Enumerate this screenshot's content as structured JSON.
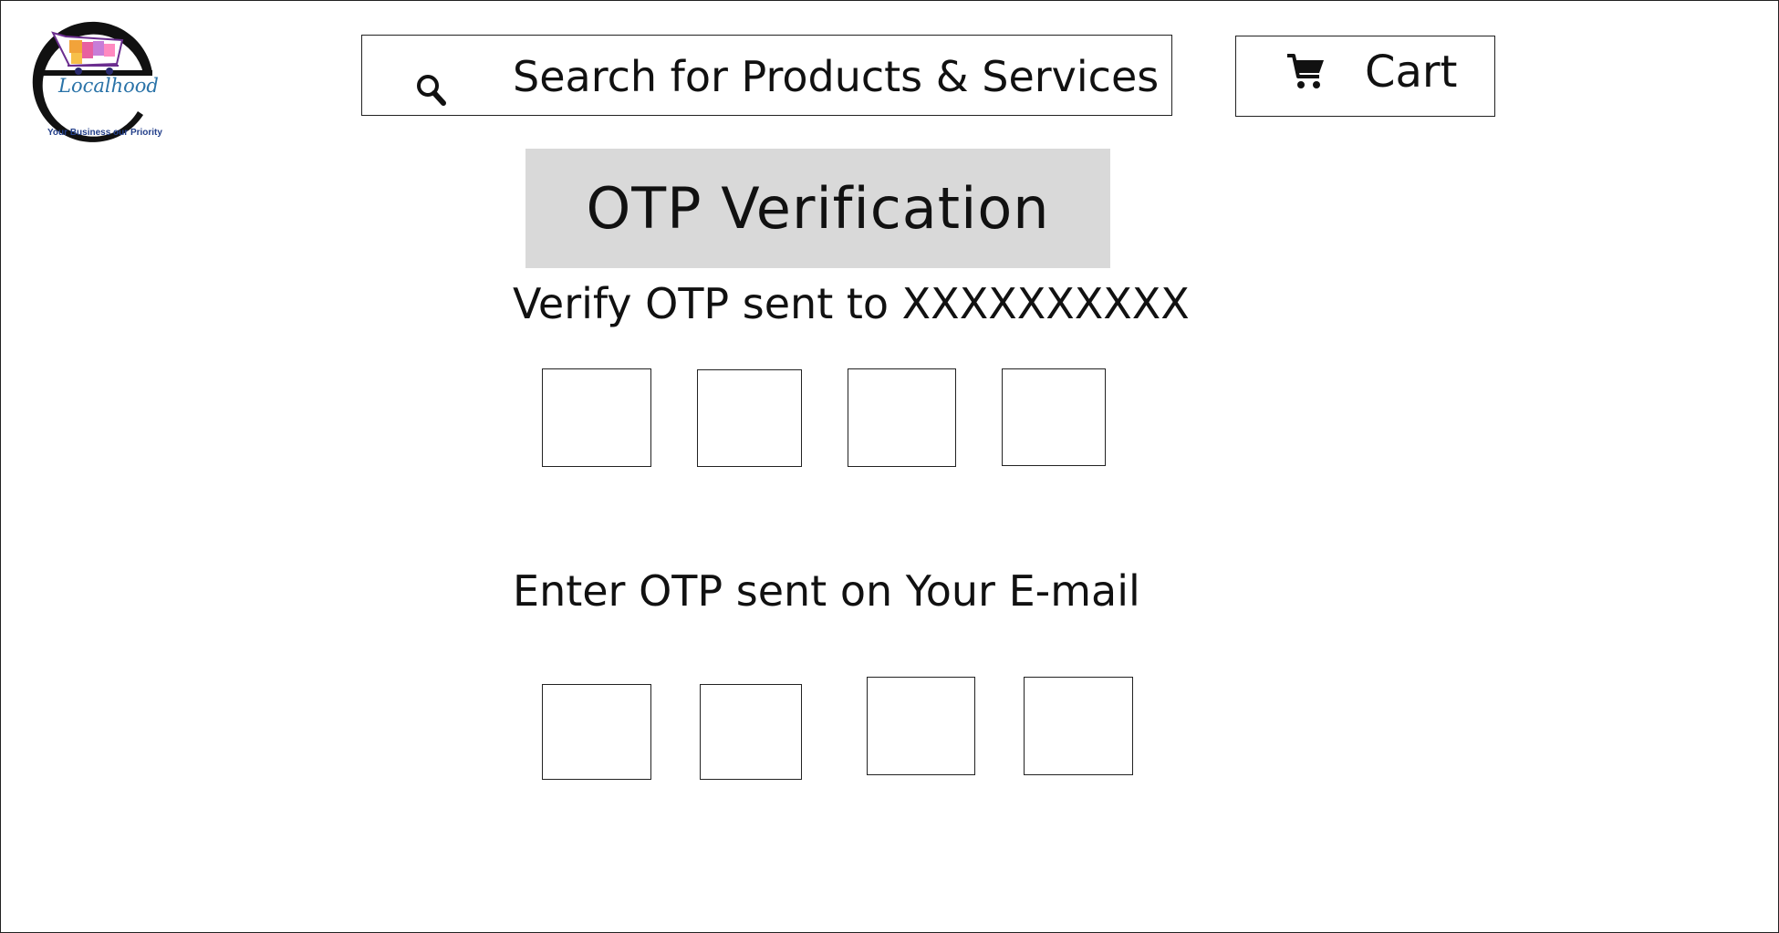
{
  "logo": {
    "brand_text": "Localhood",
    "tagline": "Your Business our Priority",
    "icon": "shopping-cart-logo-icon",
    "colors": {
      "brand": "#2a73a8",
      "tagline": "#233f8a"
    }
  },
  "header": {
    "search": {
      "placeholder": "Search for Products & Services",
      "icon": "search-icon"
    },
    "cart": {
      "label": "Cart",
      "icon": "cart-icon"
    }
  },
  "main": {
    "title": "OTP Verification",
    "phone_prompt": "Verify OTP sent to XXXXXXXXXX",
    "phone_otp_digits": [
      "",
      "",
      "",
      ""
    ],
    "email_prompt": "Enter OTP sent on Your E-mail",
    "email_otp_digits": [
      "",
      "",
      "",
      ""
    ]
  },
  "colors": {
    "title_background": "#d9d9d9",
    "border": "#222222",
    "text": "#111111"
  }
}
